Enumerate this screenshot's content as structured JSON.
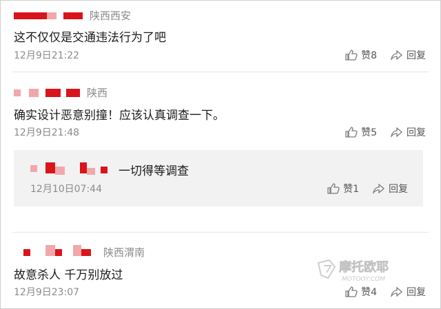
{
  "comments": [
    {
      "location": "陕西西安",
      "text": "这不仅仅是交通违法行为了吧",
      "time": "12月9日21:22",
      "likes": "赞8",
      "reply": "回复"
    },
    {
      "location": "陕西",
      "text": "确实设计恶意别撞！应该认真调查一下。",
      "time": "12月9日21:48",
      "likes": "赞5",
      "reply": "回复"
    },
    {
      "location": "陕西渭南",
      "text": "故意杀人  千万别放过",
      "time": "12月9日23:07",
      "likes": "赞4",
      "reply": "回复"
    }
  ],
  "nested_reply": {
    "text": "一切得等调查",
    "time": "12月10日07:44",
    "likes": "赞1",
    "reply": "回复"
  },
  "watermark": {
    "brand": "摩托欧耶",
    "domain": "MOTOOY.COM"
  },
  "colors": {
    "blur_red": "#d9141b",
    "blur_pink": "#f0a8aa",
    "gray_text": "#8a8a8a",
    "reply_bg": "#f2f2f2"
  }
}
